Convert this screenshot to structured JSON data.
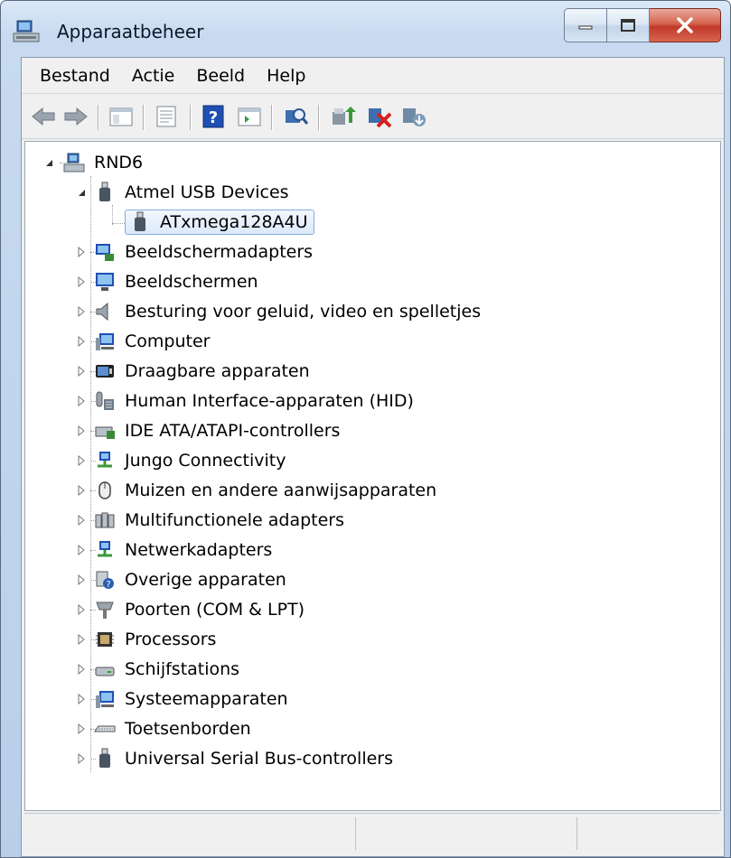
{
  "window": {
    "title": "Apparaatbeheer"
  },
  "menu": [
    "Bestand",
    "Actie",
    "Beeld",
    "Help"
  ],
  "toolbar_icons": [
    "back-arrow-icon",
    "forward-arrow-icon",
    "show-hide-tree-icon",
    "properties-icon",
    "help-icon",
    "action-pane-icon",
    "scan-hardware-icon",
    "update-driver-icon",
    "disable-device-icon",
    "uninstall-device-icon"
  ],
  "tree": {
    "root": "RND6",
    "expanded_category": "Atmel USB Devices",
    "selected_device": "ATxmega128A4U",
    "categories": [
      {
        "label": "Beeldschermadapters",
        "icon": "display-adapter-icon"
      },
      {
        "label": "Beeldschermen",
        "icon": "monitor-icon"
      },
      {
        "label": "Besturing voor geluid, video en spelletjes",
        "icon": "speaker-icon"
      },
      {
        "label": "Computer",
        "icon": "computer-icon"
      },
      {
        "label": "Draagbare apparaten",
        "icon": "portable-device-icon"
      },
      {
        "label": "Human Interface-apparaten (HID)",
        "icon": "hid-icon"
      },
      {
        "label": "IDE ATA/ATAPI-controllers",
        "icon": "ide-controller-icon"
      },
      {
        "label": "Jungo Connectivity",
        "icon": "network-icon"
      },
      {
        "label": "Muizen en andere aanwijsapparaten",
        "icon": "mouse-icon"
      },
      {
        "label": "Multifunctionele adapters",
        "icon": "multifunction-adapter-icon"
      },
      {
        "label": "Netwerkadapters",
        "icon": "network-adapter-icon"
      },
      {
        "label": "Overige apparaten",
        "icon": "unknown-device-icon"
      },
      {
        "label": "Poorten (COM & LPT)",
        "icon": "port-icon"
      },
      {
        "label": "Processors",
        "icon": "processor-icon"
      },
      {
        "label": "Schijfstations",
        "icon": "disk-drive-icon"
      },
      {
        "label": "Systeemapparaten",
        "icon": "system-device-icon"
      },
      {
        "label": "Toetsenborden",
        "icon": "keyboard-icon"
      },
      {
        "label": "Universal Serial Bus-controllers",
        "icon": "usb-icon"
      }
    ]
  },
  "colors": {
    "title_bar": "#c7daf0",
    "close_button": "#c2382a",
    "selection": "#dce9fb"
  }
}
